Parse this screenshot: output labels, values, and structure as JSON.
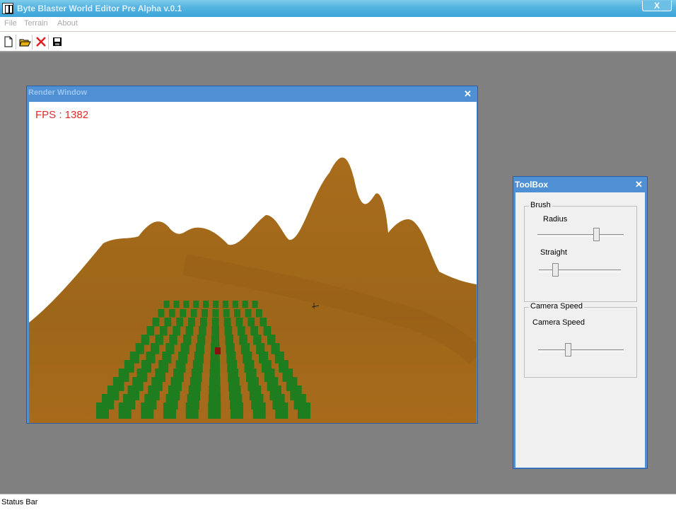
{
  "app": {
    "title": "Byte Blaster World Editor Pre Alpha v.0.1",
    "close_glyph": "X"
  },
  "menu": [
    {
      "label": "File"
    },
    {
      "label": "Terrain"
    },
    {
      "label": "About"
    }
  ],
  "toolbar": {
    "buttons": [
      {
        "name": "new-document-icon"
      },
      {
        "name": "open-folder-icon"
      },
      {
        "name": "delete-icon"
      },
      {
        "name": "save-icon"
      }
    ]
  },
  "render_window": {
    "title": "Render Window",
    "close_glyph": "✕",
    "fps_text": "FPS : 1382",
    "colors": {
      "terrain": "#a46a1f",
      "trees": "#1e7d1e",
      "marker": "#8b1010"
    }
  },
  "toolbox": {
    "title": "ToolBox",
    "close_glyph": "✕",
    "brush": {
      "title": "Brush",
      "radius_label": "Radius",
      "radius_value": 0.7,
      "straight_label": "Straight",
      "straight_value": 0.18
    },
    "camera": {
      "title": "Camera Speed",
      "label": "Camera Speed",
      "value": 0.34
    }
  },
  "status": {
    "text": "Status Bar"
  }
}
